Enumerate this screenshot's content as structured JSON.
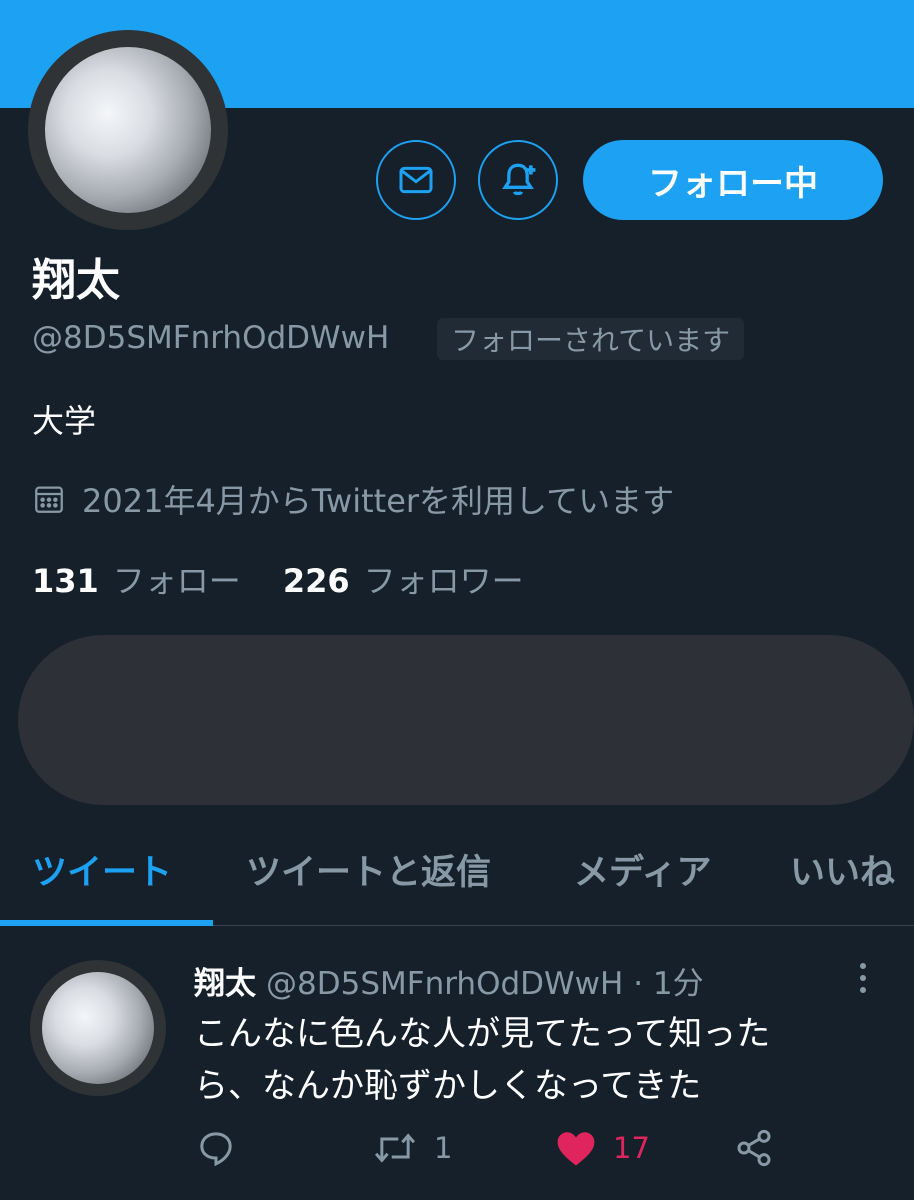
{
  "colors": {
    "accent": "#1da1f2",
    "background": "#15202b",
    "muted": "#8899a6",
    "like": "#e0245e"
  },
  "profile": {
    "display_name": "翔太",
    "handle": "@8D5SMFnrhOdDWwH",
    "follows_you": "フォローされています",
    "bio": "大学",
    "joined": "2021年4月からTwitterを利用しています",
    "following_count": "131",
    "following_label": "フォロー",
    "followers_count": "226",
    "followers_label": "フォロワー"
  },
  "actions": {
    "message_icon": "mail-icon",
    "notify_icon": "bell-plus-icon",
    "follow_label": "フォロー中"
  },
  "tabs": [
    {
      "label": "ツイート",
      "active": true
    },
    {
      "label": "ツイートと返信",
      "active": false
    },
    {
      "label": "メディア",
      "active": false
    },
    {
      "label": "いいね",
      "active": false
    }
  ],
  "tweet": {
    "name": "翔太",
    "handle": "@8D5SMFnrhOdDWwH",
    "separator": "·",
    "time": "1分",
    "line1": "こんなに色んな人が見てたって知った",
    "line2": "ら、なんか恥ずかしくなってきた",
    "reply_count": "",
    "retweet_count": "1",
    "like_count": "17"
  }
}
